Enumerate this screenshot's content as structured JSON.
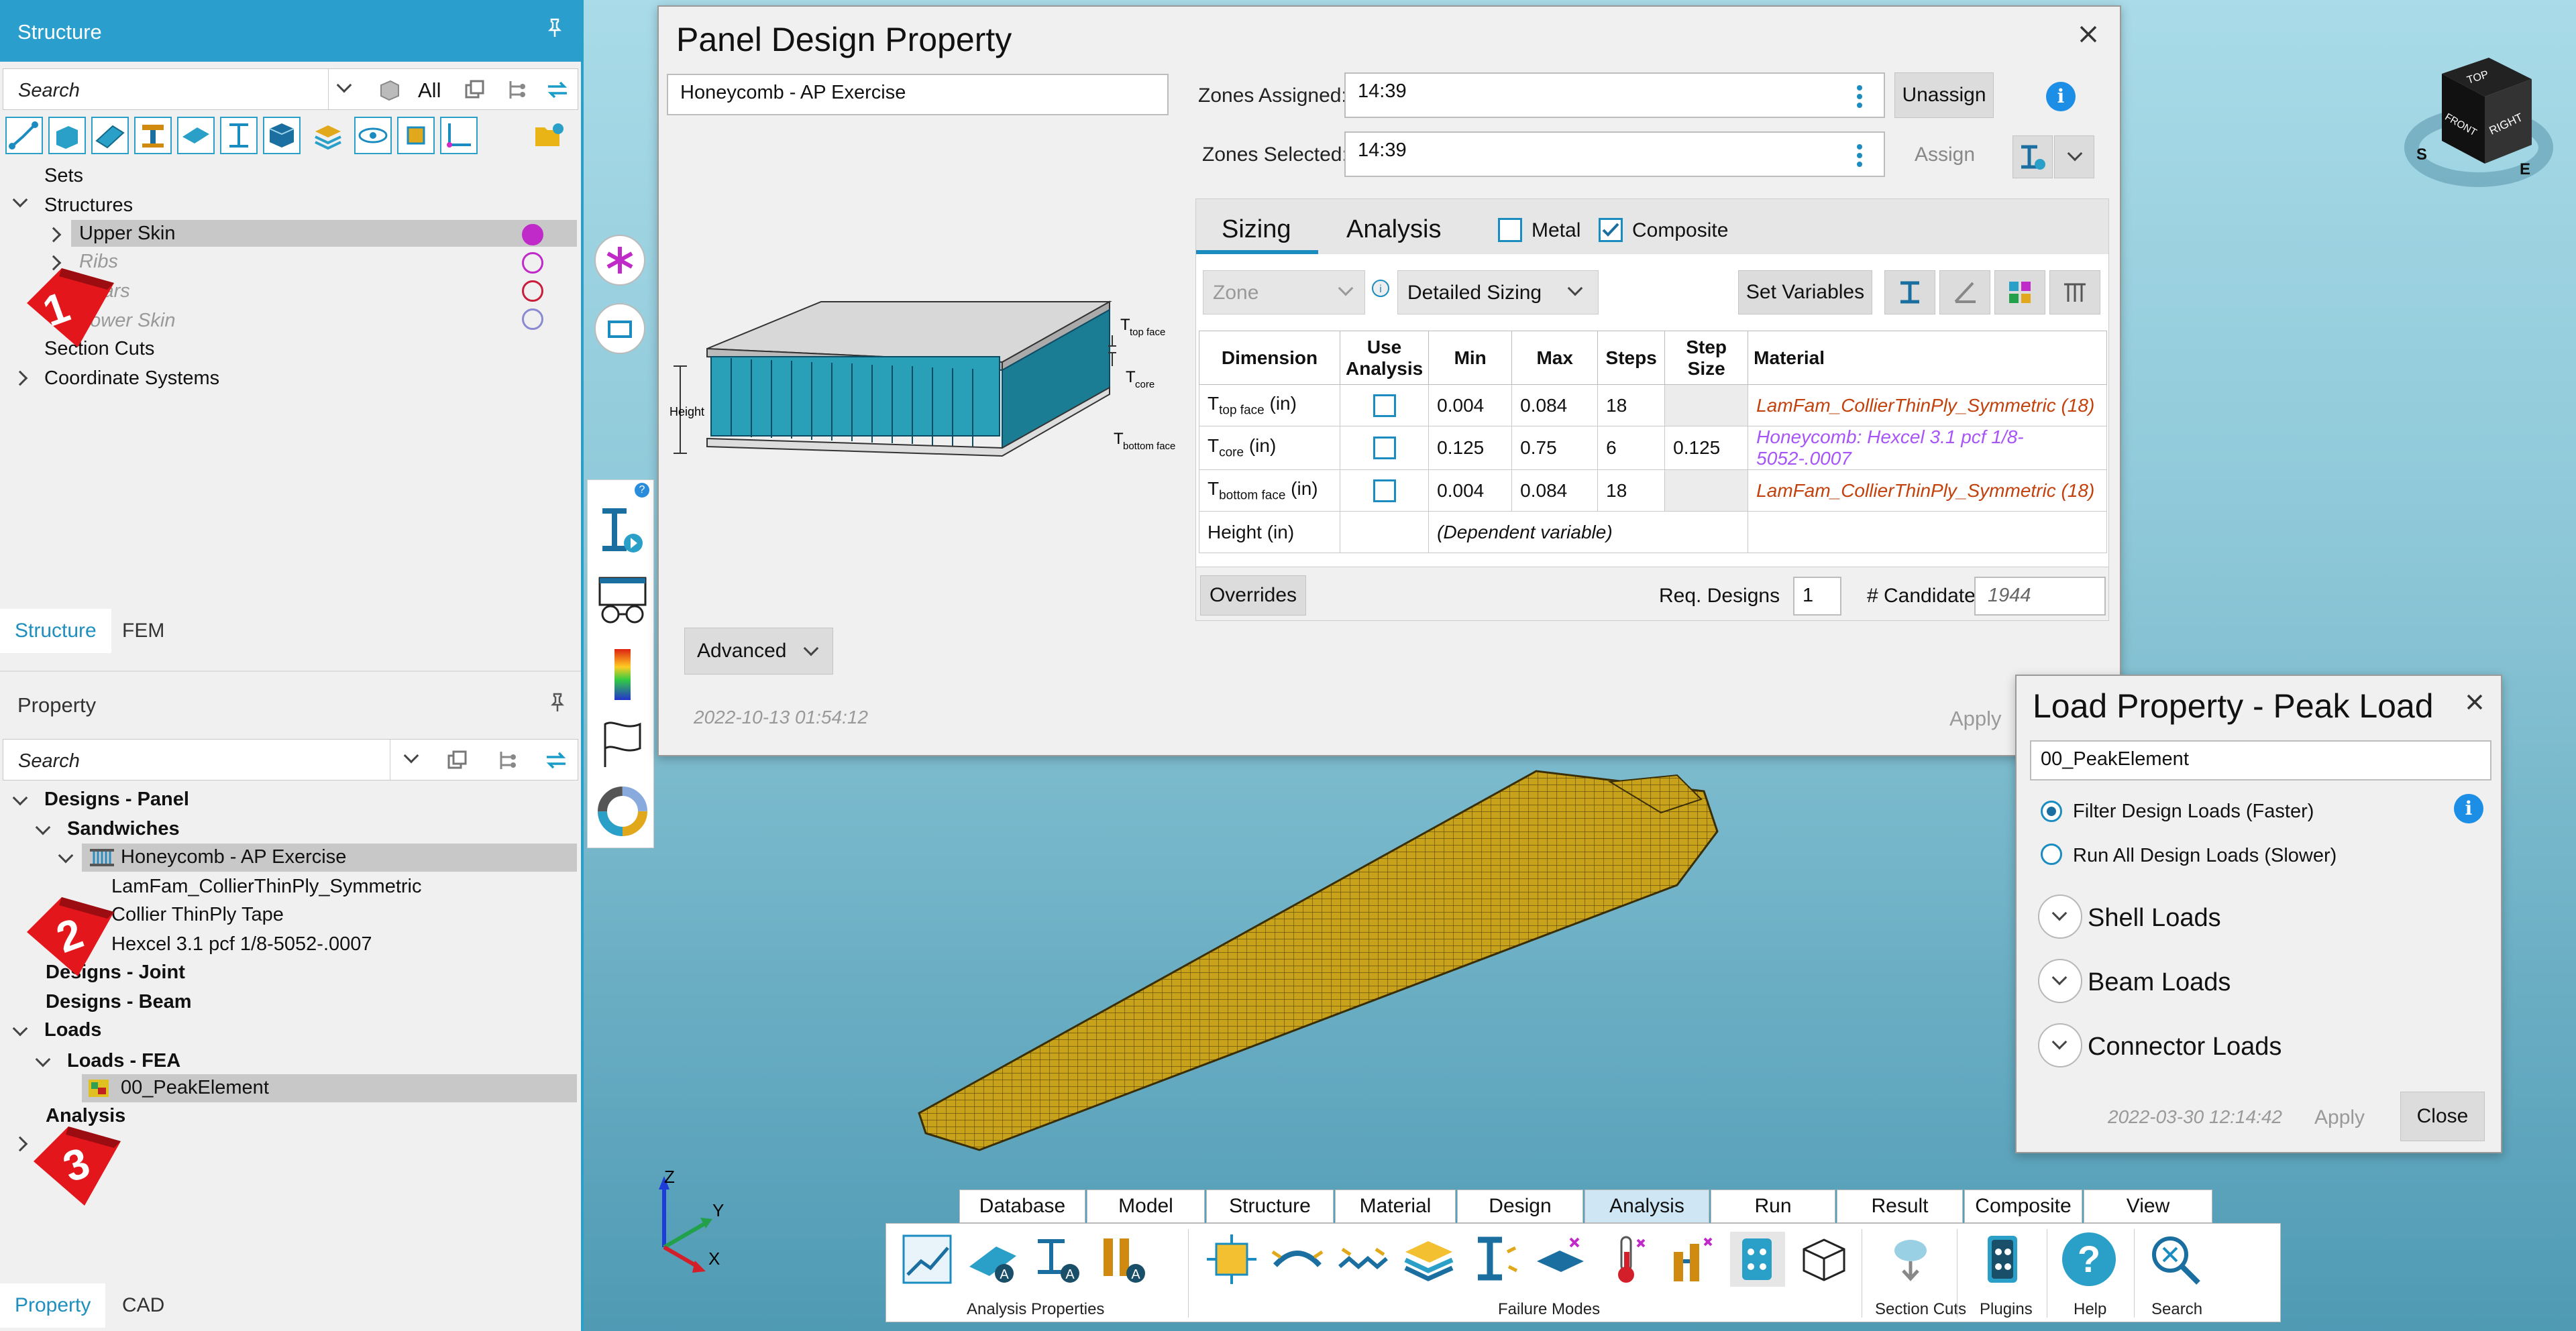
{
  "structure_panel": {
    "title": "Structure",
    "search_placeholder": "Search",
    "filter_label": "All",
    "tree": [
      "Sets",
      "Structures",
      "Upper Skin",
      "Ribs",
      "Spars",
      "Lower Skin",
      "Section Cuts",
      "Coordinate Systems"
    ],
    "tree_colors": {
      "upper_skin": "#c02ac8",
      "ribs": "#c02ac8",
      "spars": "#c81e3c",
      "lower_skin": "#8a8ad0"
    },
    "tabs": [
      "Structure",
      "FEM"
    ]
  },
  "property_panel": {
    "title": "Property",
    "search_placeholder": "Search",
    "tree": [
      "Designs - Panel",
      "Sandwiches",
      "Honeycomb - AP Exercise",
      "LamFam_CollierThinPly_Symmetric",
      "Collier ThinPly Tape",
      "Hexcel 3.1 pcf 1/8-5052-.0007",
      "Designs - Joint",
      "Designs - Beam",
      "Loads",
      "Loads - FEA",
      "00_PeakElement",
      "Analysis"
    ],
    "tabs": [
      "Property",
      "CAD"
    ]
  },
  "badges": [
    "1",
    "2",
    "3"
  ],
  "panel_dialog": {
    "title": "Panel Design Property",
    "name": "Honeycomb - AP Exercise",
    "zones_assigned_label": "Zones Assigned:",
    "zones_assigned": "14:39",
    "zones_selected_label": "Zones Selected:",
    "zones_selected": "14:39",
    "unassign": "Unassign",
    "assign": "Assign",
    "tabs": [
      "Sizing",
      "Analysis"
    ],
    "metal": "Metal",
    "composite": "Composite",
    "zone_placeholder": "Zone",
    "sizing_mode": "Detailed Sizing",
    "set_variables": "Set Variables",
    "figure_labels": {
      "top": "T",
      "top_sub": "top face",
      "core": "T",
      "core_sub": "core",
      "bottom": "T",
      "bottom_sub": "bottom face",
      "height": "Height"
    },
    "columns": [
      "Dimension",
      "Use Analysis",
      "Min",
      "Max",
      "Steps",
      "Step Size",
      "Material"
    ],
    "rows": [
      {
        "dim": "T",
        "sub": "top face",
        "unit": " (in)",
        "min": "0.004",
        "max": "0.084",
        "steps": "18",
        "step": "",
        "material": "LamFam_CollierThinPly_Symmetric (18)"
      },
      {
        "dim": "T",
        "sub": "core",
        "unit": " (in)",
        "min": "0.125",
        "max": "0.75",
        "steps": "6",
        "step": "0.125",
        "material": "Honeycomb: Hexcel 3.1 pcf 1/8-5052-.0007"
      },
      {
        "dim": "T",
        "sub": "bottom face",
        "unit": " (in)",
        "min": "0.004",
        "max": "0.084",
        "steps": "18",
        "step": "",
        "material": "LamFam_CollierThinPly_Symmetric (18)"
      },
      {
        "dim": "Height (in)",
        "dependent": "(Dependent variable)"
      }
    ],
    "overrides": "Overrides",
    "req_designs_label": "Req. Designs",
    "req_designs": "1",
    "candidates_label": "# Candidates",
    "candidates": "1944",
    "advanced": "Advanced",
    "timestamp": "2022-10-13 01:54:12",
    "apply": "Apply"
  },
  "load_dialog": {
    "title": "Load Property - Peak Load",
    "name": "00_PeakElement",
    "option1": "Filter Design Loads (Faster)",
    "option2": "Run All Design Loads (Slower)",
    "sections": [
      "Shell Loads",
      "Beam Loads",
      "Connector Loads"
    ],
    "timestamp": "2022-03-30 12:14:42",
    "apply": "Apply",
    "close": "Close"
  },
  "viewcube": {
    "top": "TOP",
    "front": "FRONT",
    "right": "RIGHT",
    "s": "S",
    "e": "E"
  },
  "axes": {
    "x": "X",
    "y": "Y",
    "z": "Z"
  },
  "ribbon": {
    "tabs": [
      "Database",
      "Model",
      "Structure",
      "Material",
      "Design",
      "Analysis",
      "Run",
      "Result",
      "Composite",
      "View"
    ],
    "active_tab": "Analysis",
    "groups": [
      "Analysis Properties",
      "Failure Modes",
      "Section Cuts",
      "Plugins",
      "Help",
      "Search"
    ]
  },
  "colors": {
    "accent": "#2a9fcd",
    "badge": "#e3161b",
    "mesh": "#c8a21a"
  }
}
